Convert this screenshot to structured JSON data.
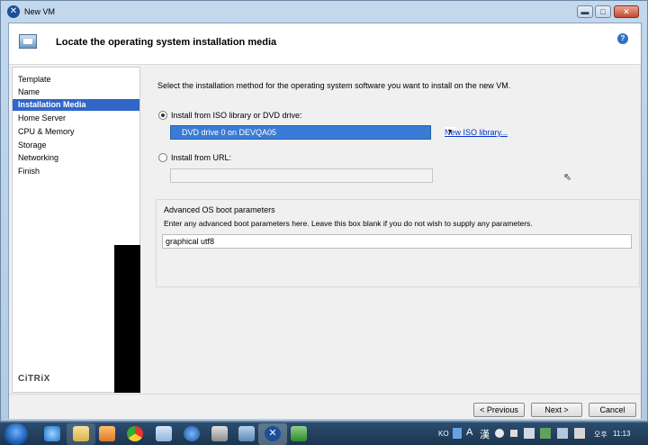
{
  "window": {
    "title": "New VM",
    "min_glyph": "▬",
    "max_glyph": "□",
    "close_glyph": "✕"
  },
  "header": {
    "title": "Locate the operating system installation media",
    "help_glyph": "?"
  },
  "nav": {
    "items": [
      {
        "label": "Template",
        "active": false
      },
      {
        "label": "Name",
        "active": false
      },
      {
        "label": "Installation Media",
        "active": true
      },
      {
        "label": "Home Server",
        "active": false
      },
      {
        "label": "CPU & Memory",
        "active": false
      },
      {
        "label": "Storage",
        "active": false
      },
      {
        "label": "Networking",
        "active": false
      },
      {
        "label": "Finish",
        "active": false
      }
    ],
    "logo": "CiTRiX"
  },
  "main": {
    "intro": "Select the installation method for the operating system software you want to install on the new VM.",
    "iso_option_label": "Install from ISO library or DVD drive:",
    "iso_selected": "DVD drive 0 on DEVQA05",
    "new_iso_link": "New ISO library...",
    "url_option_label": "Install from URL:",
    "url_value": "",
    "advanced": {
      "title": "Advanced OS boot parameters",
      "description": "Enter any advanced boot parameters here. Leave this box blank if you do not wish to supply any parameters.",
      "value": "graphical utf8"
    }
  },
  "buttons": {
    "previous": "< Previous",
    "next": "Next >",
    "cancel": "Cancel"
  },
  "taskbar": {
    "lang": "KO",
    "ime_a": "A",
    "ime_han": "漢",
    "ampm": "오후",
    "time": "11:13"
  },
  "colors": {
    "accent": "#3266c8",
    "selection": "#3a7bd5",
    "link": "#0033cc"
  }
}
